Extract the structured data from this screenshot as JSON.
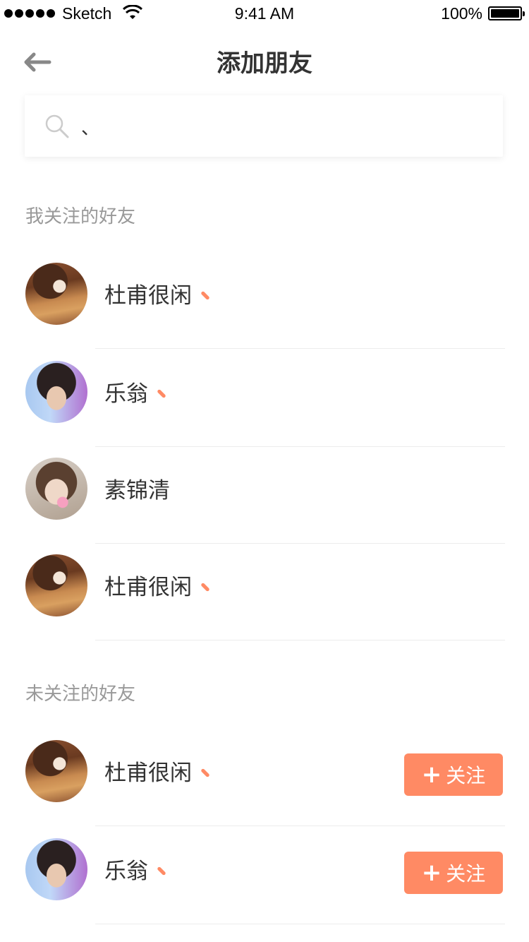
{
  "status_bar": {
    "carrier": "Sketch",
    "time": "9:41 AM",
    "battery": "100%"
  },
  "nav": {
    "title": "添加朋友",
    "back_icon": "arrow-left-icon"
  },
  "search": {
    "value": "、",
    "placeholder": "",
    "icon": "search-icon"
  },
  "accent_color": "#ff8a64",
  "followed_section": {
    "title": "我关注的好友",
    "items": [
      {
        "name": "杜甫很闲",
        "mark": true
      },
      {
        "name": "乐翁",
        "mark": true
      },
      {
        "name": "素锦清",
        "mark": false
      },
      {
        "name": "杜甫很闲",
        "mark": true
      }
    ]
  },
  "unfollowed_section": {
    "title": "未关注的好友",
    "follow_label": "关注",
    "items": [
      {
        "name": "杜甫很闲",
        "mark": true
      },
      {
        "name": "乐翁",
        "mark": true
      }
    ]
  }
}
